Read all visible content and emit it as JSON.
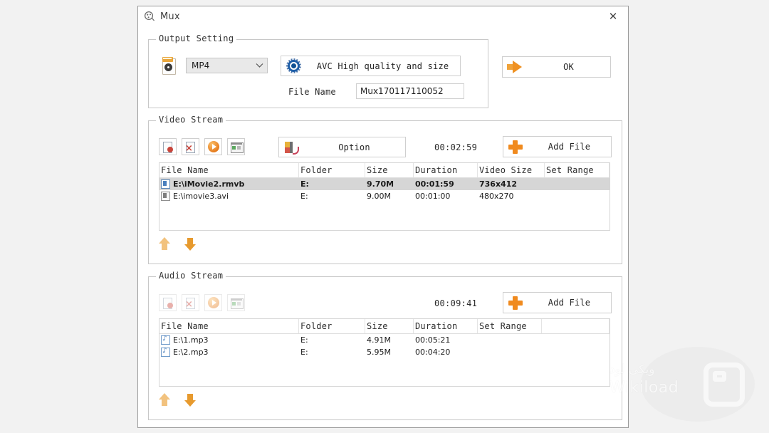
{
  "window": {
    "title": "Mux",
    "app_icon": "mux-app-icon",
    "close_label": "✕"
  },
  "output_setting": {
    "group_title": "Output Setting",
    "format_icon": "video-format-file-icon",
    "format_value": "MP4",
    "format_options": [
      "MP4"
    ],
    "chevron": "⌄",
    "quality_icon": "blue-gear-icon",
    "quality_label": "AVC High quality and size",
    "filename_label": "File Name",
    "filename_value": "Mux170117110052",
    "ok_icon": "orange-arrow-right-icon",
    "ok_label": "OK"
  },
  "video_stream": {
    "group_title": "Video Stream",
    "toolbar": [
      {
        "icon": "delete-file-icon",
        "disabled": false
      },
      {
        "icon": "clear-list-icon",
        "disabled": false
      },
      {
        "icon": "play-icon",
        "disabled": false
      },
      {
        "icon": "preview-icon",
        "disabled": false
      }
    ],
    "option_icon": "option-settings-icon",
    "option_label": "Option",
    "duration_total": "00:02:59",
    "add_file_icon": "plus-icon",
    "add_file_label": "Add File",
    "columns": [
      "File Name",
      "Folder",
      "Size",
      "Duration",
      "Video Size",
      "Set Range"
    ],
    "rows": [
      {
        "icon": "video-file-icon",
        "file_name": "E:\\iMovie2.rmvb",
        "folder": "E:",
        "size": "9.70M",
        "duration": "00:01:59",
        "video_size": "736x412",
        "set_range": "",
        "selected": true
      },
      {
        "icon": "video-file-icon",
        "file_name": "E:\\imovie3.avi",
        "folder": "E:",
        "size": "9.00M",
        "duration": "00:01:00",
        "video_size": "480x270",
        "set_range": "",
        "selected": false
      }
    ],
    "move_up_icon": "move-up-arrow-icon",
    "move_down_icon": "move-down-arrow-icon"
  },
  "audio_stream": {
    "group_title": "Audio Stream",
    "toolbar": [
      {
        "icon": "delete-file-icon",
        "disabled": true
      },
      {
        "icon": "clear-list-icon",
        "disabled": true
      },
      {
        "icon": "play-icon",
        "disabled": true
      },
      {
        "icon": "preview-icon",
        "disabled": true
      }
    ],
    "duration_total": "00:09:41",
    "add_file_icon": "plus-icon",
    "add_file_label": "Add File",
    "columns": [
      "File Name",
      "Folder",
      "Size",
      "Duration",
      "Set Range"
    ],
    "rows": [
      {
        "icon": "audio-file-icon",
        "file_name": "E:\\1.mp3",
        "folder": "E:",
        "size": "4.91M",
        "duration": "00:05:21",
        "set_range": "",
        "selected": false
      },
      {
        "icon": "audio-file-icon",
        "file_name": "E:\\2.mp3",
        "folder": "E:",
        "size": "5.95M",
        "duration": "00:04:20",
        "set_range": "",
        "selected": false
      }
    ],
    "move_up_icon": "move-up-arrow-icon",
    "move_down_icon": "move-down-arrow-icon"
  },
  "watermark": {
    "text_arabic": "ویکی لود",
    "text_latin": "Wikiload",
    "logo_icon": "wikiload-logo-icon"
  },
  "colors": {
    "accent_orange": "#f08a1e",
    "gear_blue": "#1f5fa8",
    "selection_gray": "#d6d6d6",
    "page_background": "#f2f2f2"
  }
}
